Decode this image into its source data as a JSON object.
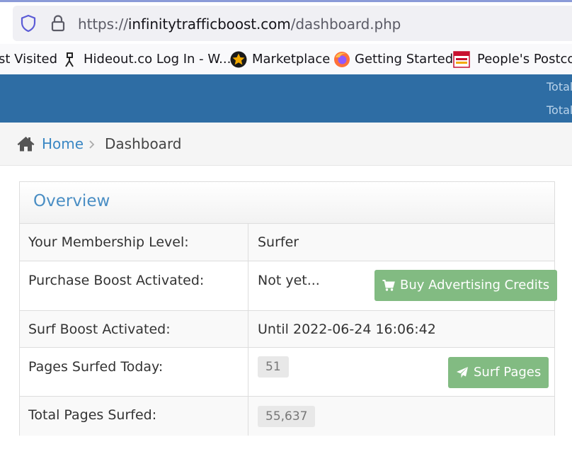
{
  "browser": {
    "url_scheme": "https://",
    "url_host": "infinitytrafficboost.com",
    "url_path": "/dashboard.php",
    "bookmarks": [
      {
        "label": "st Visited",
        "icon": "most-visited"
      },
      {
        "label": "Hideout.co Log In - W...",
        "icon": "hideout-favicon"
      },
      {
        "label": "Marketplace",
        "icon": "marketplace-star-favicon"
      },
      {
        "label": "Getting Started",
        "icon": "firefox-favicon"
      },
      {
        "label": "People's Postcode",
        "icon": "postcode-lottery-favicon"
      }
    ]
  },
  "header": {
    "stat_1": "Total",
    "stat_2": "Total",
    "color": "#2e6da4"
  },
  "breadcrumb": {
    "home": "Home",
    "current": "Dashboard"
  },
  "overview": {
    "title": "Overview",
    "rows": [
      {
        "label": "Your Membership Level:",
        "value": "Surfer"
      },
      {
        "label": "Purchase Boost Activated:",
        "value": "Not yet...",
        "button": "Buy Advertising Credits",
        "button_icon": "cart-icon"
      },
      {
        "label": "Surf Boost Activated:",
        "value": "Until 2022-06-24 16:06:42"
      },
      {
        "label": "Pages Surfed Today:",
        "value": "51",
        "button": "Surf Pages",
        "button_icon": "paper-plane-icon"
      },
      {
        "label": "Total Pages Surfed:",
        "value": "55,637"
      }
    ],
    "button_color": "#82bb82"
  }
}
